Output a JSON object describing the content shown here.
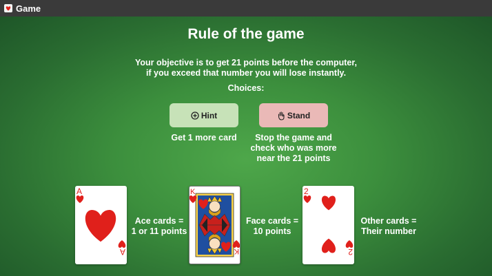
{
  "window": {
    "title": "Game",
    "icon": "app-card-icon"
  },
  "page": {
    "heading": "Rule of the game",
    "objective_line1": "Your objective is to get 21 points before the computer,",
    "objective_line2": "if you exceed that number you will lose instantly.",
    "choices_label": "Choices:"
  },
  "buttons": {
    "hint": {
      "label": "Hint",
      "icon": "plus-circle-icon",
      "description": "Get 1 more card"
    },
    "stand": {
      "label": "Stand",
      "icon": "hand-icon",
      "description_line1": "Stop the game and",
      "description_line2": "check who was more",
      "description_line3": "near the 21 points"
    }
  },
  "cards": [
    {
      "rank": "A",
      "suit": "hearts",
      "label_line1": "Ace cards =",
      "label_line2": "1 or 11 points"
    },
    {
      "rank": "K",
      "suit": "hearts",
      "label_line1": "Face cards =",
      "label_line2": "10 points"
    },
    {
      "rank": "2",
      "suit": "hearts",
      "label_line1": "Other cards =",
      "label_line2": "Their number"
    }
  ],
  "colors": {
    "titlebar": "#3a3a3a",
    "felt_center": "#4ea74a",
    "felt_edge": "#1e5628",
    "hint_button": "#c7e2b8",
    "stand_button": "#eab9b7",
    "suit_red": "#e0201b"
  }
}
